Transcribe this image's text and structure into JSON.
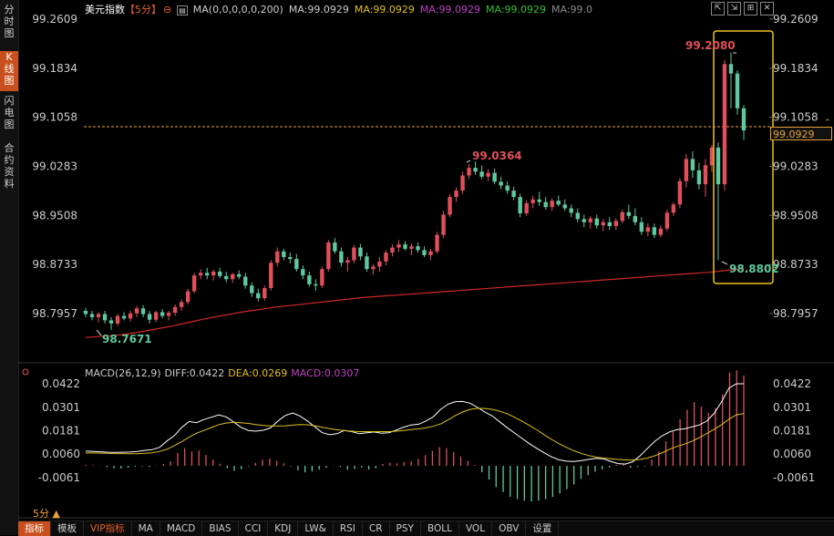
{
  "sidebar": {
    "tabs": [
      {
        "label": "分时图",
        "active": false
      },
      {
        "label": "K线图",
        "active": true
      },
      {
        "label": "闪电图",
        "active": false
      },
      {
        "label": "合约资料",
        "active": false
      }
    ]
  },
  "header": {
    "symbol": "美元指数",
    "period": "【5分】",
    "ma_params": "MA(0,0,0,0,0,200)",
    "ma_values": [
      {
        "text": "MA:99.0929",
        "color": "#cccccc"
      },
      {
        "text": "MA:99.0929",
        "color": "#e0c020"
      },
      {
        "text": "MA:99.0929",
        "color": "#c040c0"
      },
      {
        "text": "MA:99.0929",
        "color": "#30c030"
      },
      {
        "text": "MA:99.0",
        "color": "#888888"
      }
    ]
  },
  "toolbar": {
    "buttons": [
      "⇱",
      "⇲",
      "⊞",
      "✕"
    ]
  },
  "price_axis": {
    "right_labels": [
      "99.2609",
      "99.1834",
      "99.1058",
      "99.0283",
      "98.9508",
      "98.8733",
      "98.7957"
    ],
    "left_labels": [
      "99.2609",
      "99.1834",
      "99.1058",
      "99.0283",
      "98.9508",
      "98.8733",
      "98.7957"
    ],
    "current_price": "99.0929"
  },
  "annotations": {
    "high": "99.2080",
    "mid_high": "99.0364",
    "low_right": "98.8802",
    "low_left": "98.7671"
  },
  "macd": {
    "title": "MACD(26,12,9)",
    "diff": "DIFF:0.0422",
    "dea": "DEA:0.0269",
    "macd": "MACD:0.0307",
    "axis": [
      "0.0422",
      "0.0301",
      "0.0181",
      "0.0060",
      "-0.0061"
    ]
  },
  "colors": {
    "up": "#e0505a",
    "down": "#5ec9a0",
    "ma200": "#d02828",
    "highlight": "#f0c020",
    "accent": "#c8501e"
  },
  "period_selector": "5分 ▲",
  "bottom_tabs": [
    {
      "label": "指标",
      "active": true
    },
    {
      "label": "模板",
      "active": false
    },
    {
      "label": "VIP指标",
      "active": false,
      "vip": true
    },
    {
      "label": "MA",
      "active": false
    },
    {
      "label": "MACD",
      "active": false
    },
    {
      "label": "BIAS",
      "active": false
    },
    {
      "label": "CCI",
      "active": false
    },
    {
      "label": "KDJ",
      "active": false
    },
    {
      "label": "LW&",
      "active": false
    },
    {
      "label": "RSI",
      "active": false
    },
    {
      "label": "CR",
      "active": false
    },
    {
      "label": "PSY",
      "active": false
    },
    {
      "label": "BOLL",
      "active": false
    },
    {
      "label": "VOL",
      "active": false
    },
    {
      "label": "OBV",
      "active": false
    },
    {
      "label": "设置",
      "active": false
    }
  ],
  "candles": [
    [
      98.8,
      98.805,
      98.79,
      98.795
    ],
    [
      98.795,
      98.8,
      98.785,
      98.79
    ],
    [
      98.79,
      98.798,
      98.782,
      98.795
    ],
    [
      98.795,
      98.8,
      98.78,
      98.785
    ],
    [
      98.785,
      98.79,
      98.77,
      98.78
    ],
    [
      98.78,
      98.795,
      98.776,
      98.792
    ],
    [
      98.792,
      98.798,
      98.785,
      98.788
    ],
    [
      98.788,
      98.8,
      98.783,
      98.796
    ],
    [
      98.796,
      98.808,
      98.79,
      98.804
    ],
    [
      98.804,
      98.809,
      98.79,
      98.795
    ],
    [
      98.795,
      98.8,
      98.78,
      98.786
    ],
    [
      98.786,
      98.8,
      98.782,
      98.798
    ],
    [
      98.798,
      98.803,
      98.788,
      98.792
    ],
    [
      98.792,
      98.8,
      98.785,
      98.797
    ],
    [
      98.797,
      98.81,
      98.792,
      98.806
    ],
    [
      98.806,
      98.818,
      98.8,
      98.814
    ],
    [
      98.814,
      98.835,
      98.81,
      98.831
    ],
    [
      98.831,
      98.86,
      98.828,
      98.856
    ],
    [
      98.856,
      98.866,
      98.85,
      98.86
    ],
    [
      98.86,
      98.868,
      98.85,
      98.856
    ],
    [
      98.856,
      98.865,
      98.848,
      98.862
    ],
    [
      98.862,
      98.868,
      98.852,
      98.855
    ],
    [
      98.855,
      98.862,
      98.845,
      98.85
    ],
    [
      98.85,
      98.86,
      98.844,
      98.858
    ],
    [
      98.858,
      98.864,
      98.85,
      98.854
    ],
    [
      98.854,
      98.86,
      98.835,
      98.84
    ],
    [
      98.84,
      98.845,
      98.822,
      98.828
    ],
    [
      98.828,
      98.835,
      98.815,
      98.82
    ],
    [
      98.82,
      98.84,
      98.816,
      98.836
    ],
    [
      98.836,
      98.88,
      98.832,
      98.876
    ],
    [
      98.876,
      98.9,
      98.87,
      98.894
    ],
    [
      98.894,
      98.898,
      98.88,
      98.885
    ],
    [
      98.885,
      98.892,
      98.875,
      98.882
    ],
    [
      98.882,
      98.89,
      98.862,
      98.866
    ],
    [
      98.866,
      98.872,
      98.85,
      98.856
    ],
    [
      98.856,
      98.862,
      98.838,
      98.842
    ],
    [
      98.842,
      98.85,
      98.832,
      98.84
    ],
    [
      98.84,
      98.87,
      98.836,
      98.866
    ],
    [
      98.866,
      98.912,
      98.862,
      98.908
    ],
    [
      98.908,
      98.915,
      98.89,
      98.894
    ],
    [
      98.894,
      98.9,
      98.87,
      98.876
    ],
    [
      98.876,
      98.885,
      98.862,
      98.88
    ],
    [
      98.88,
      98.904,
      98.875,
      98.9
    ],
    [
      98.9,
      98.906,
      98.88,
      98.886
    ],
    [
      98.886,
      98.892,
      98.862,
      98.866
    ],
    [
      98.866,
      98.874,
      98.858,
      98.87
    ],
    [
      98.87,
      98.885,
      98.862,
      98.878
    ],
    [
      98.878,
      98.896,
      98.872,
      98.892
    ],
    [
      98.892,
      98.905,
      98.886,
      98.9
    ],
    [
      98.9,
      98.912,
      98.893,
      98.905
    ],
    [
      98.905,
      98.91,
      98.895,
      98.898
    ],
    [
      98.898,
      98.906,
      98.888,
      98.902
    ],
    [
      98.902,
      98.908,
      98.892,
      98.896
    ],
    [
      98.896,
      98.902,
      98.885,
      98.888
    ],
    [
      98.888,
      98.898,
      98.88,
      98.894
    ],
    [
      98.894,
      98.925,
      98.89,
      98.92
    ],
    [
      98.92,
      98.958,
      98.915,
      98.952
    ],
    [
      98.952,
      98.985,
      98.948,
      98.98
    ],
    [
      98.98,
      98.995,
      98.972,
      98.99
    ],
    [
      98.99,
      99.02,
      98.985,
      99.014
    ],
    [
      99.014,
      99.032,
      99.008,
      99.026
    ],
    [
      99.026,
      99.036,
      99.015,
      99.02
    ],
    [
      99.02,
      99.03,
      99.008,
      99.012
    ],
    [
      99.012,
      99.024,
      99.005,
      99.018
    ],
    [
      99.018,
      99.025,
      99.0,
      99.004
    ],
    [
      99.004,
      99.012,
      98.992,
      98.998
    ],
    [
      98.998,
      99.005,
      98.985,
      98.99
    ],
    [
      98.99,
      98.996,
      98.975,
      98.98
    ],
    [
      98.98,
      98.985,
      98.948,
      98.954
    ],
    [
      98.954,
      98.975,
      98.95,
      98.97
    ],
    [
      98.97,
      98.982,
      98.962,
      98.976
    ],
    [
      98.976,
      98.988,
      98.966,
      98.972
    ],
    [
      98.972,
      98.98,
      98.96,
      98.964
    ],
    [
      98.964,
      98.978,
      98.958,
      98.974
    ],
    [
      98.974,
      98.982,
      98.965,
      98.968
    ],
    [
      98.968,
      98.976,
      98.958,
      98.962
    ],
    [
      98.962,
      98.968,
      98.948,
      98.955
    ],
    [
      98.955,
      98.962,
      98.94,
      98.945
    ],
    [
      98.945,
      98.952,
      98.932,
      98.94
    ],
    [
      98.94,
      98.95,
      98.93,
      98.946
    ],
    [
      98.946,
      98.952,
      98.93,
      98.935
    ],
    [
      98.935,
      98.945,
      98.926,
      98.94
    ],
    [
      98.94,
      98.948,
      98.928,
      98.934
    ],
    [
      98.934,
      98.946,
      98.928,
      98.942
    ],
    [
      98.942,
      98.96,
      98.938,
      98.956
    ],
    [
      98.956,
      98.968,
      98.945,
      98.95
    ],
    [
      98.95,
      98.962,
      98.935,
      98.94
    ],
    [
      98.94,
      98.948,
      98.92,
      98.925
    ],
    [
      98.925,
      98.938,
      98.918,
      98.932
    ],
    [
      98.932,
      98.938,
      98.915,
      98.92
    ],
    [
      98.92,
      98.935,
      98.916,
      98.93
    ],
    [
      98.93,
      98.96,
      98.926,
      98.955
    ],
    [
      98.955,
      98.972,
      98.95,
      98.968
    ],
    [
      98.968,
      99.01,
      98.962,
      99.005
    ],
    [
      99.005,
      99.048,
      98.995,
      99.04
    ],
    [
      99.04,
      99.052,
      99.01,
      99.022
    ],
    [
      99.022,
      99.034,
      98.992,
      99.0
    ],
    [
      99.0,
      99.04,
      98.98,
      99.03
    ],
    [
      99.03,
      99.062,
      99.02,
      99.058
    ],
    [
      99.058,
      99.066,
      98.88,
      99.0
    ],
    [
      99.0,
      99.196,
      98.99,
      99.19
    ],
    [
      99.19,
      99.208,
      99.12,
      99.175
    ],
    [
      99.175,
      99.18,
      99.11,
      99.12
    ],
    [
      99.12,
      99.125,
      99.07,
      99.085
    ]
  ],
  "ma200": [
    98.758,
    98.76,
    98.762,
    98.766,
    98.771,
    98.776,
    98.782,
    98.788,
    98.793,
    98.798,
    98.802,
    98.806,
    98.809,
    98.812,
    98.815,
    98.818,
    98.821,
    98.823,
    98.825,
    98.827,
    98.829,
    98.831,
    98.833,
    98.835,
    98.837,
    98.839,
    98.841,
    98.843,
    98.845,
    98.847,
    98.849,
    98.851,
    98.853,
    98.855,
    98.857,
    98.859,
    98.861,
    98.864,
    98.867
  ],
  "macd_series": {
    "hist": [
      0.0003,
      0.0002,
      0.0001,
      -0.0005,
      -0.0008,
      -0.0009,
      -0.0006,
      -0.0003,
      -0.0002,
      -0.0004,
      0.0001,
      0.0006,
      0.0014,
      0.0041,
      0.0057,
      0.0046,
      0.0049,
      0.0035,
      0.002,
      0.0007,
      -0.0008,
      -0.0016,
      -0.0011,
      -0.0002,
      0.0009,
      0.002,
      0.0023,
      0.0016,
      0.0008,
      -0.0002,
      -0.0015,
      -0.0021,
      -0.0018,
      -0.0012,
      -0.0006,
      0.0001,
      -0.0004,
      -0.0013,
      -0.001,
      -0.0005,
      -0.0012,
      -0.0008,
      0.0006,
      0.001,
      0.0008,
      0.0012,
      0.0015,
      0.0022,
      0.0034,
      0.0048,
      0.006,
      0.0057,
      0.0044,
      0.003,
      0.0016,
      0.0003,
      -0.0021,
      -0.0044,
      -0.0068,
      -0.0084,
      -0.01,
      -0.0107,
      -0.0112,
      -0.0115,
      -0.0112,
      -0.0108,
      -0.01,
      -0.0089,
      -0.0075,
      -0.006,
      -0.0042,
      -0.003,
      -0.0019,
      -0.0012,
      -0.0005,
      0.0003,
      0.0008,
      -0.0006,
      -0.0003,
      -0.0002,
      0.002,
      0.0046,
      0.0079,
      0.011,
      0.015,
      0.018,
      0.0205,
      0.019,
      0.017,
      0.0185,
      0.023,
      0.03,
      0.0307,
      0.029
    ],
    "diff": [
      0.0076,
      0.0074,
      0.0072,
      0.007,
      0.0069,
      0.007,
      0.0071,
      0.0074,
      0.0079,
      0.0083,
      0.0095,
      0.0128,
      0.0155,
      0.0198,
      0.0228,
      0.0222,
      0.0238,
      0.025,
      0.0262,
      0.0252,
      0.0226,
      0.0198,
      0.0182,
      0.0178,
      0.0183,
      0.0195,
      0.023,
      0.0259,
      0.0272,
      0.0256,
      0.023,
      0.02,
      0.017,
      0.016,
      0.0165,
      0.0182,
      0.0176,
      0.0165,
      0.017,
      0.0174,
      0.0168,
      0.017,
      0.0184,
      0.0199,
      0.021,
      0.0214,
      0.023,
      0.0252,
      0.029,
      0.0317,
      0.033,
      0.0331,
      0.0322,
      0.03,
      0.0276,
      0.0256,
      0.0226,
      0.0196,
      0.0169,
      0.0141,
      0.0114,
      0.009,
      0.0067,
      0.0046,
      0.0031,
      0.0024,
      0.0022,
      0.0026,
      0.0033,
      0.0038,
      0.0036,
      0.0023,
      0.0011,
      0.0009,
      0.0021,
      0.0052,
      0.009,
      0.0127,
      0.0155,
      0.0175,
      0.0186,
      0.019,
      0.02,
      0.021,
      0.023,
      0.027,
      0.033,
      0.04,
      0.0422,
      0.0422
    ],
    "dea": [
      0.0066,
      0.0066,
      0.0065,
      0.0064,
      0.0063,
      0.0063,
      0.0062,
      0.0062,
      0.0064,
      0.0067,
      0.0074,
      0.0085,
      0.0104,
      0.0124,
      0.0148,
      0.0168,
      0.0182,
      0.0197,
      0.0212,
      0.022,
      0.0224,
      0.0222,
      0.0218,
      0.0212,
      0.0207,
      0.0205,
      0.0205,
      0.0206,
      0.0209,
      0.0212,
      0.0211,
      0.0206,
      0.0198,
      0.0191,
      0.0185,
      0.0181,
      0.0178,
      0.0176,
      0.0176,
      0.0176,
      0.0176,
      0.0176,
      0.0178,
      0.0182,
      0.0186,
      0.019,
      0.0195,
      0.0203,
      0.0215,
      0.0236,
      0.0259,
      0.0277,
      0.029,
      0.0296,
      0.0295,
      0.029,
      0.0281,
      0.0268,
      0.025,
      0.023,
      0.0208,
      0.0185,
      0.016,
      0.0136,
      0.0114,
      0.0095,
      0.0078,
      0.0064,
      0.0053,
      0.0045,
      0.004,
      0.0036,
      0.0033,
      0.003,
      0.003,
      0.0033,
      0.004,
      0.0052,
      0.0068,
      0.0086,
      0.01,
      0.0112,
      0.0126,
      0.0145,
      0.0166,
      0.0188,
      0.0212,
      0.024,
      0.0262,
      0.0269
    ]
  }
}
